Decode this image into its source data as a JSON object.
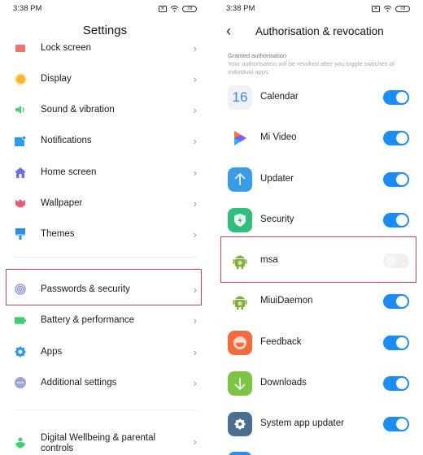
{
  "left": {
    "status": {
      "time": "3:38 PM",
      "battery": "78"
    },
    "title": "Settings",
    "items": [
      {
        "label": "Lock screen",
        "icon": "lock-screen-icon",
        "color": "#f0736b"
      },
      {
        "label": "Display",
        "icon": "sun-icon",
        "color": "#f7b731"
      },
      {
        "label": "Sound & vibration",
        "icon": "speaker-icon",
        "color": "#4cd07d"
      },
      {
        "label": "Notifications",
        "icon": "notification-icon",
        "color": "#2d9cf0"
      },
      {
        "label": "Home screen",
        "icon": "home-icon",
        "color": "#6c6ee6"
      },
      {
        "label": "Wallpaper",
        "icon": "tulip-icon",
        "color": "#ee5b78"
      },
      {
        "label": "Themes",
        "icon": "brush-icon",
        "color": "#2d8cf0"
      },
      {
        "label": "Passwords & security",
        "icon": "fingerprint-icon",
        "color": "#7b7fe0"
      },
      {
        "label": "Battery & performance",
        "icon": "battery-icon",
        "color": "#3ecf75"
      },
      {
        "label": "Apps",
        "icon": "gear-icon",
        "color": "#2d9cf0"
      },
      {
        "label": "Additional settings",
        "icon": "more-icon",
        "color": "#9aa6d8"
      },
      {
        "label": "Digital Wellbeing & parental controls",
        "icon": "wellbeing-icon",
        "color": "#3ecf75"
      }
    ],
    "chevron": "›"
  },
  "right": {
    "status": {
      "time": "3:38 PM",
      "battery": "78"
    },
    "back": "‹",
    "title": "Authorisation & revocation",
    "section_header": "Granted authorisation",
    "section_desc": "Your authorisation will be revoked after you toggle switches of individual apps.",
    "apps": [
      {
        "label": "Calendar",
        "icon": "calendar-icon",
        "icon_text": "16",
        "enabled": true
      },
      {
        "label": "Mi Video",
        "icon": "mi-video-icon",
        "enabled": true
      },
      {
        "label": "Updater",
        "icon": "updater-icon",
        "enabled": true
      },
      {
        "label": "Security",
        "icon": "security-shield-icon",
        "enabled": true
      },
      {
        "label": "msa",
        "icon": "android-icon",
        "enabled": false
      },
      {
        "label": "MiuiDaemon",
        "icon": "android-icon",
        "enabled": true
      },
      {
        "label": "Feedback",
        "icon": "feedback-icon",
        "enabled": true
      },
      {
        "label": "Downloads",
        "icon": "downloads-icon",
        "enabled": true
      },
      {
        "label": "System app updater",
        "icon": "system-updater-gear-icon",
        "enabled": true
      }
    ],
    "accent": "#1a8cf5",
    "highlight": "#d8424b"
  }
}
